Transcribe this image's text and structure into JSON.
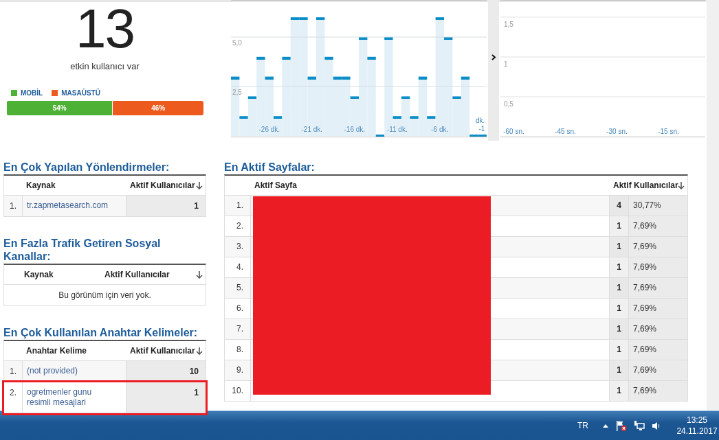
{
  "active_users": {
    "count": "13",
    "caption": "etkin kullanıcı var"
  },
  "device_split": {
    "legend": [
      {
        "label": "MOBİL",
        "color": "#4cb134"
      },
      {
        "label": "MASAÜSTÜ",
        "color": "#ec5a1d"
      }
    ],
    "level": 0.54,
    "segments": [
      {
        "label": "54%",
        "color": "#4cb134"
      },
      {
        "label": "46%",
        "color": "#ec5a1d"
      }
    ]
  },
  "per_minute_chart": {
    "chart_data": {
      "type": "bar",
      "x": [
        -30,
        -29,
        -28,
        -27,
        -26,
        -25,
        -24,
        -23,
        -22,
        -21,
        -20,
        -19,
        -18,
        -17,
        -16,
        -15,
        -14,
        -13,
        -12,
        -11,
        -10,
        -9,
        -8,
        -7,
        -6,
        -5,
        -4,
        -3,
        -2,
        -1
      ],
      "values": [
        3,
        1,
        2,
        4,
        3,
        1,
        4,
        6,
        6,
        3,
        6,
        4,
        3,
        3,
        2,
        5,
        4,
        0,
        5,
        1,
        2,
        1,
        3,
        1,
        6,
        5,
        2,
        3,
        0,
        0
      ],
      "xlim": [
        -30.5,
        -0.5
      ],
      "ylim": [
        0,
        6.875
      ],
      "grid": true,
      "yticks": [
        {
          "value": 2.5,
          "label": "2,5"
        },
        {
          "value": 5,
          "label": "5,0"
        }
      ],
      "xticks": [
        {
          "value": -26,
          "label": "-26 dk."
        },
        {
          "value": -21,
          "label": "-21 dk."
        },
        {
          "value": -16,
          "label": "-16 dk."
        },
        {
          "value": -11,
          "label": "-11 dk."
        },
        {
          "value": -6,
          "label": "-6 dk."
        },
        {
          "value": -1,
          "label": "dk. -1"
        }
      ]
    }
  },
  "per_second_chart": {
    "chart_data": {
      "type": "bar",
      "xlim": [
        -63.9,
        -4.3
      ],
      "ylim": [
        0,
        1.715
      ],
      "grid": true,
      "yticks": [
        {
          "value": 0.5,
          "label": "0,5"
        },
        {
          "value": 1,
          "label": "1"
        },
        {
          "value": 1.5,
          "label": "1,5"
        }
      ],
      "xticks": [
        {
          "value": -60,
          "label": "-60 sn."
        },
        {
          "value": -45,
          "label": "-45 sn."
        },
        {
          "value": -30,
          "label": "-30 sn."
        },
        {
          "value": -15,
          "label": "-15 sn."
        }
      ]
    }
  },
  "referrals": {
    "title": "En Çok Yapılan Yönlendirmeler:",
    "columns": [
      "Kaynak",
      "Aktif Kullanıcılar"
    ],
    "rows": [
      {
        "index": "1.",
        "source": "tr.zapmetasearch.com",
        "users": "1"
      }
    ]
  },
  "social": {
    "title": "En Fazla Trafik Getiren Sosyal Kanallar:",
    "columns": [
      "Kaynak",
      "Aktif Kullanıcılar"
    ],
    "empty_message": "Bu görünüm için veri yok."
  },
  "keywords": {
    "title": "En Çok Kullanılan Anahtar Kelimeler:",
    "columns": [
      "Anahtar Kelime",
      "Aktif Kullanıcılar"
    ],
    "rows": [
      {
        "index": "1.",
        "keyword": "(not provided)",
        "users": "10",
        "highlighted": false
      },
      {
        "index": "2.",
        "keyword": "ogretmenler gunu resimli mesajlari",
        "users": "1",
        "highlighted": true
      }
    ]
  },
  "pages": {
    "title": "En Aktif Sayfalar:",
    "columns": [
      "Aktif Sayfa",
      "Aktif Kullanıcılar"
    ],
    "redacted": true,
    "rows": [
      {
        "index": "1.",
        "users": "4",
        "share": "30,77%"
      },
      {
        "index": "2.",
        "users": "1",
        "share": "7,69%"
      },
      {
        "index": "3.",
        "users": "1",
        "share": "7,69%"
      },
      {
        "index": "4.",
        "users": "1",
        "share": "7,69%"
      },
      {
        "index": "5.",
        "users": "1",
        "share": "7,69%"
      },
      {
        "index": "6.",
        "users": "1",
        "share": "7,69%"
      },
      {
        "index": "7.",
        "users": "1",
        "share": "7,69%"
      },
      {
        "index": "8.",
        "users": "1",
        "share": "7,69%"
      },
      {
        "index": "9.",
        "users": "1",
        "share": "7,69%"
      },
      {
        "index": "10.",
        "users": "1",
        "share": "7,69%"
      }
    ]
  },
  "taskbar": {
    "language": "TR",
    "time": "13:25",
    "date": "24.11.2017"
  }
}
